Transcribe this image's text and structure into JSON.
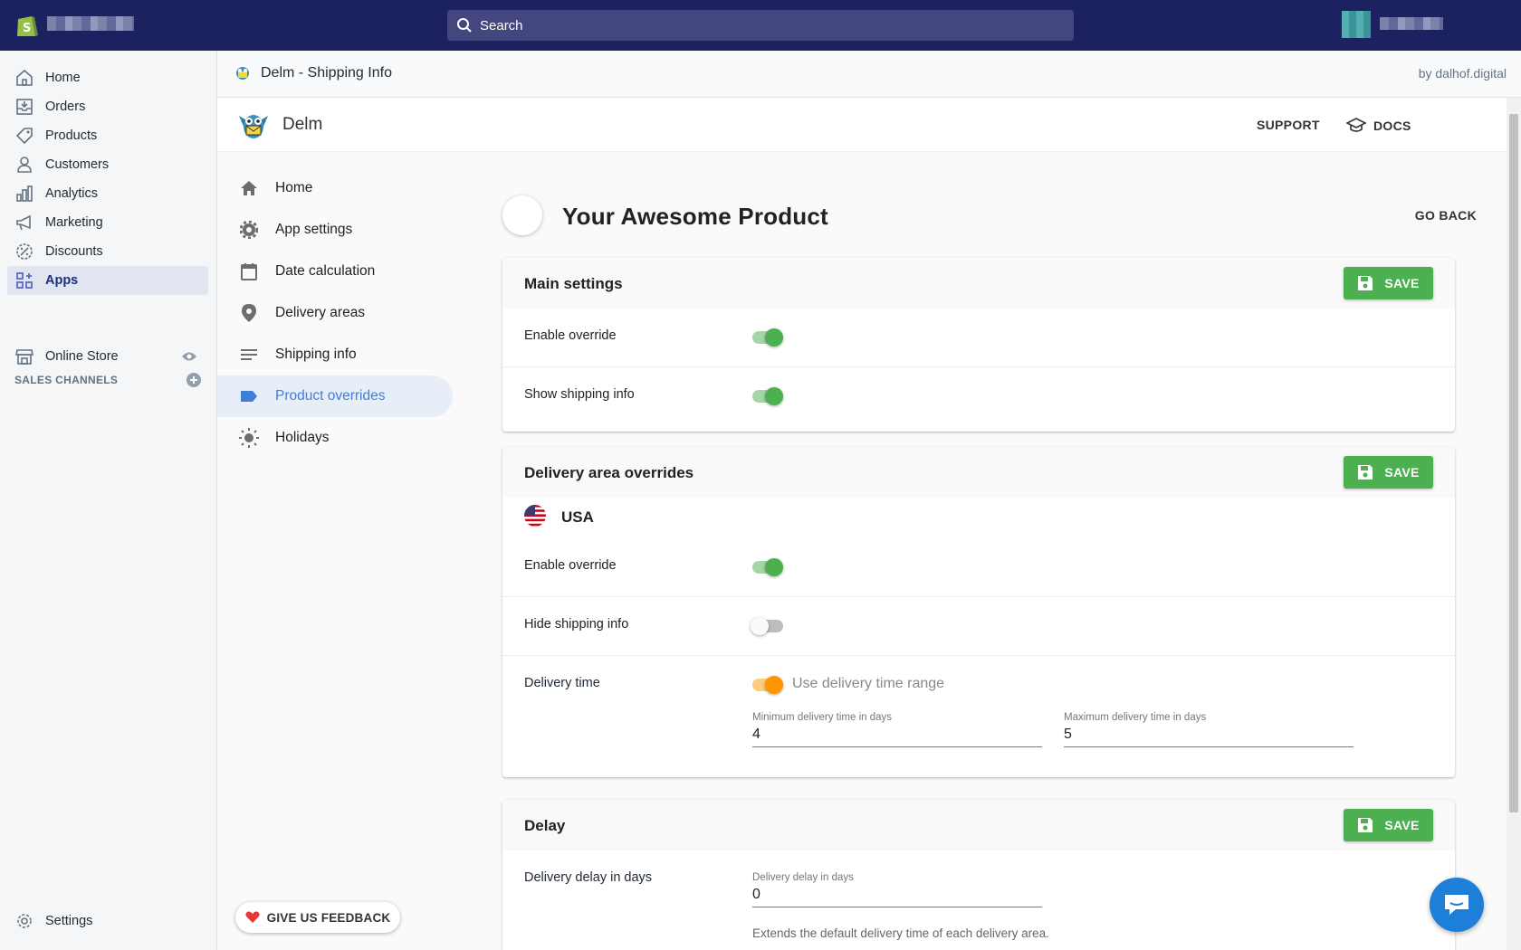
{
  "topbar": {
    "search_placeholder": "Search"
  },
  "leftnav": {
    "items": [
      {
        "label": "Home",
        "icon": "home-icon"
      },
      {
        "label": "Orders",
        "icon": "orders-icon"
      },
      {
        "label": "Products",
        "icon": "tag-icon"
      },
      {
        "label": "Customers",
        "icon": "person-icon"
      },
      {
        "label": "Analytics",
        "icon": "bar-chart-icon"
      },
      {
        "label": "Marketing",
        "icon": "megaphone-icon"
      },
      {
        "label": "Discounts",
        "icon": "discount-icon"
      },
      {
        "label": "Apps",
        "icon": "apps-icon",
        "active": true
      }
    ],
    "sales_channels_header": "SALES CHANNELS",
    "online_store": "Online Store",
    "settings": "Settings"
  },
  "appbar": {
    "title": "Delm - Shipping Info",
    "by": "by dalhof.digital"
  },
  "app": {
    "brand": "Delm",
    "support": "SUPPORT",
    "docs": "DOCS",
    "menu": [
      {
        "label": "Home",
        "icon": "home-icon"
      },
      {
        "label": "App settings",
        "icon": "gear-icon"
      },
      {
        "label": "Date calculation",
        "icon": "calendar-icon"
      },
      {
        "label": "Delivery areas",
        "icon": "location-pin-icon"
      },
      {
        "label": "Shipping info",
        "icon": "lines-icon"
      },
      {
        "label": "Product overrides",
        "icon": "label-icon",
        "active": true
      },
      {
        "label": "Holidays",
        "icon": "sun-icon"
      }
    ],
    "feedback": "GIVE US FEEDBACK"
  },
  "product": {
    "name": "Your Awesome Product",
    "go_back": "GO BACK"
  },
  "main_settings": {
    "title": "Main settings",
    "save": "SAVE",
    "enable_override": "Enable override",
    "enable_override_on": true,
    "show_shipping_info": "Show shipping info",
    "show_shipping_info_on": true
  },
  "delivery_area": {
    "title": "Delivery area overrides",
    "save": "SAVE",
    "country": "USA",
    "enable_override": "Enable override",
    "enable_override_on": true,
    "hide_shipping_info": "Hide shipping info",
    "hide_shipping_info_on": false,
    "delivery_time": "Delivery time",
    "use_range": "Use delivery time range",
    "use_range_on": true,
    "min_label": "Minimum delivery time in days",
    "min_value": "4",
    "max_label": "Maximum delivery time in days",
    "max_value": "5"
  },
  "delay": {
    "title": "Delay",
    "save": "SAVE",
    "label": "Delivery delay in days",
    "field_label": "Delivery delay in days",
    "value": "0",
    "help": "Extends the default delivery time of each delivery area."
  },
  "colors": {
    "topbar": "#1c2260",
    "save_green": "#4caf50",
    "active_blue": "#3f7fd7",
    "toggle_orange": "#ff9800"
  }
}
